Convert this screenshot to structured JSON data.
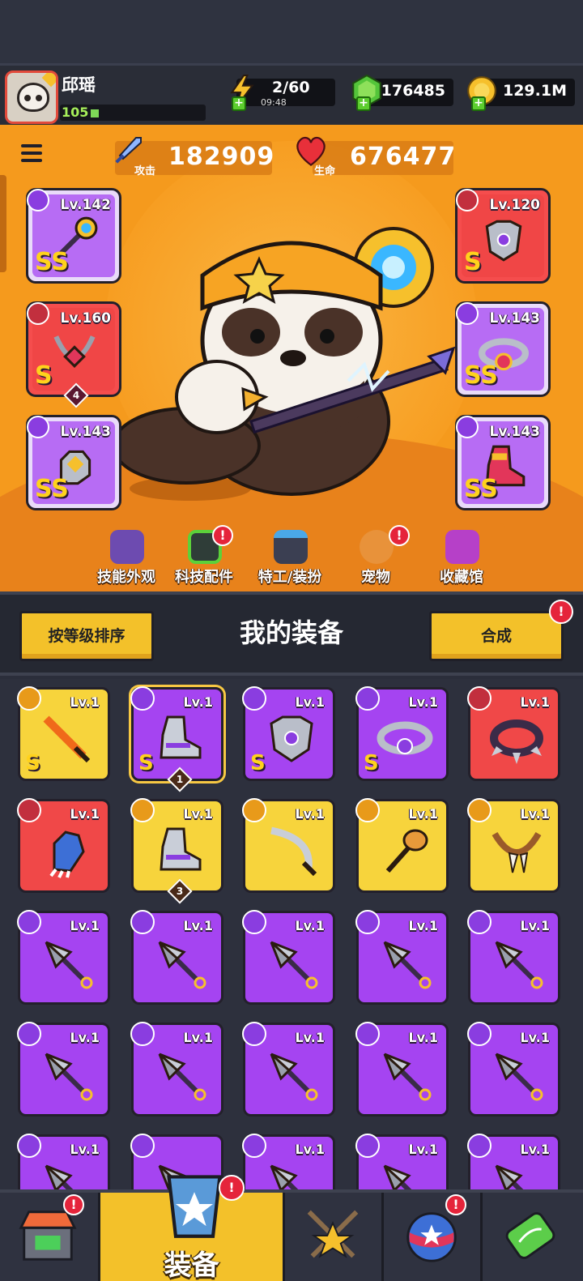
{
  "player": {
    "name": "邱瑶",
    "level": "105",
    "xp_fraction": 0.08
  },
  "resources": {
    "energy": "2/60",
    "energy_timer": "09:48",
    "gems": "176485",
    "coins": "129.1M"
  },
  "stats": {
    "attack_label": "攻击",
    "attack_value": "182909",
    "hp_label": "生命",
    "hp_value": "676477"
  },
  "equipped": {
    "left": [
      {
        "level": "Lv.142",
        "rank": "SS",
        "rarity": "purple",
        "icon": "staff-icon"
      },
      {
        "level": "Lv.160",
        "rank": "S",
        "rarity": "red",
        "icon": "necklace-icon",
        "stars": "4"
      },
      {
        "level": "Lv.143",
        "rank": "SS",
        "rarity": "purple",
        "icon": "glove-icon"
      }
    ],
    "right": [
      {
        "level": "Lv.120",
        "rank": "S",
        "rarity": "red",
        "icon": "armor-icon"
      },
      {
        "level": "Lv.143",
        "rank": "SS",
        "rarity": "purple",
        "icon": "belt-icon"
      },
      {
        "level": "Lv.143",
        "rank": "SS",
        "rarity": "purple",
        "icon": "boots-icon"
      }
    ]
  },
  "hero_nav": [
    {
      "label": "技能外观",
      "icon": "skill-skin-icon",
      "alert": false
    },
    {
      "label": "科技配件",
      "icon": "tech-parts-icon",
      "alert": true
    },
    {
      "label": "特工/装扮",
      "icon": "agent-icon",
      "alert": false
    },
    {
      "label": "宠物",
      "icon": "pet-icon",
      "alert": true
    },
    {
      "label": "收藏馆",
      "icon": "collection-icon",
      "alert": false
    }
  ],
  "equipment_header": {
    "sort_label": "按等级排序",
    "title": "我的装备",
    "craft_label": "合成",
    "alert_mark": "!"
  },
  "inventory": [
    {
      "level": "Lv.1",
      "rarity": "yellow",
      "rank": "S",
      "icon": "sword-icon"
    },
    {
      "level": "Lv.1",
      "rarity": "purple",
      "rank": "S",
      "icon": "boots-icon",
      "count": "1",
      "selected": true
    },
    {
      "level": "Lv.1",
      "rarity": "purple",
      "rank": "S",
      "icon": "armor-icon"
    },
    {
      "level": "Lv.1",
      "rarity": "purple",
      "rank": "S",
      "icon": "belt-icon"
    },
    {
      "level": "Lv.1",
      "rarity": "red",
      "rank": "",
      "icon": "spiked-collar-icon"
    },
    {
      "level": "Lv.1",
      "rarity": "red",
      "rank": "",
      "icon": "claw-glove-icon"
    },
    {
      "level": "Lv.1",
      "rarity": "yellow",
      "rank": "",
      "icon": "boots-icon",
      "count": "3"
    },
    {
      "level": "Lv.1",
      "rarity": "yellow",
      "rank": "",
      "icon": "scimitar-icon"
    },
    {
      "level": "Lv.1",
      "rarity": "yellow",
      "rank": "",
      "icon": "torch-staff-icon"
    },
    {
      "level": "Lv.1",
      "rarity": "yellow",
      "rank": "",
      "icon": "fang-necklace-icon"
    },
    {
      "level": "Lv.1",
      "rarity": "purple",
      "rank": "",
      "icon": "kunai-icon"
    },
    {
      "level": "Lv.1",
      "rarity": "purple",
      "rank": "",
      "icon": "kunai-icon"
    },
    {
      "level": "Lv.1",
      "rarity": "purple",
      "rank": "",
      "icon": "kunai-icon"
    },
    {
      "level": "Lv.1",
      "rarity": "purple",
      "rank": "",
      "icon": "kunai-icon"
    },
    {
      "level": "Lv.1",
      "rarity": "purple",
      "rank": "",
      "icon": "kunai-icon"
    },
    {
      "level": "Lv.1",
      "rarity": "purple",
      "rank": "",
      "icon": "kunai-icon"
    },
    {
      "level": "Lv.1",
      "rarity": "purple",
      "rank": "",
      "icon": "kunai-icon"
    },
    {
      "level": "Lv.1",
      "rarity": "purple",
      "rank": "",
      "icon": "kunai-icon"
    },
    {
      "level": "Lv.1",
      "rarity": "purple",
      "rank": "",
      "icon": "kunai-icon"
    },
    {
      "level": "Lv.1",
      "rarity": "purple",
      "rank": "",
      "icon": "kunai-icon"
    },
    {
      "level": "Lv.1",
      "rarity": "purple",
      "rank": "",
      "icon": "kunai-icon"
    },
    {
      "level": "",
      "rarity": "purple",
      "rank": "",
      "icon": "kunai-icon"
    },
    {
      "level": "Lv.1",
      "rarity": "purple",
      "rank": "",
      "icon": "kunai-icon"
    },
    {
      "level": "Lv.1",
      "rarity": "purple",
      "rank": "",
      "icon": "kunai-icon"
    },
    {
      "level": "Lv.1",
      "rarity": "purple",
      "rank": "",
      "icon": "kunai-icon"
    }
  ],
  "bottom_nav": [
    {
      "label": "",
      "icon": "shop-icon",
      "alert": true
    },
    {
      "label": "装备",
      "icon": "equipment-icon",
      "alert": true,
      "active": true
    },
    {
      "label": "",
      "icon": "battle-icon",
      "alert": false
    },
    {
      "label": "",
      "icon": "talent-orb-icon",
      "alert": true
    },
    {
      "label": "",
      "icon": "dna-evolution-icon",
      "alert": false
    }
  ],
  "colors": {
    "hero_bg": "#f59a1d",
    "yellow_rarity": "#f7d43c",
    "purple_rarity": "#a544f1",
    "red_rarity": "#f04848",
    "button_yellow": "#f3c12a",
    "alert_red": "#e5243b"
  }
}
